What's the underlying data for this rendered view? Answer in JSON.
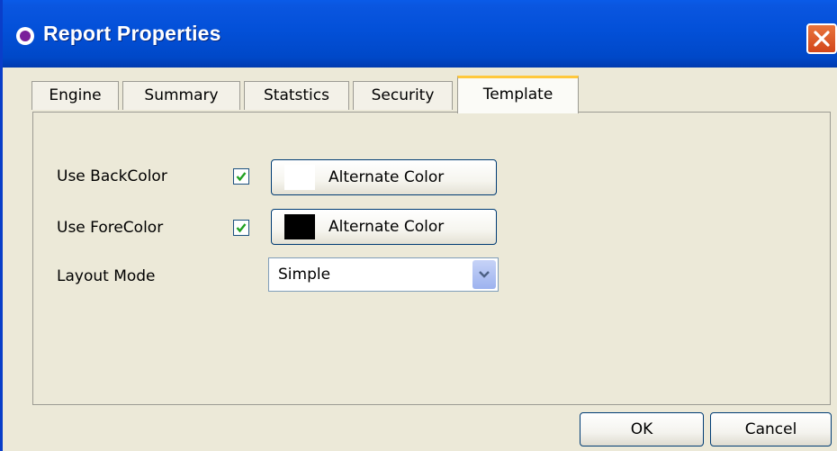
{
  "window": {
    "title": "Report Properties",
    "icon": "report-app-icon",
    "close_icon": "close-icon"
  },
  "tabs": [
    {
      "label": "Engine",
      "active": false
    },
    {
      "label": "Summary",
      "active": false
    },
    {
      "label": "Statstics",
      "active": false
    },
    {
      "label": "Security",
      "active": false
    },
    {
      "label": "Template",
      "active": true
    }
  ],
  "template": {
    "use_backcolor": {
      "label": "Use BackColor",
      "checked": true,
      "button_label": "Alternate Color",
      "swatch_color": "#ffffff"
    },
    "use_forecolor": {
      "label": "Use ForeColor",
      "checked": true,
      "button_label": "Alternate Color",
      "swatch_color": "#000000"
    },
    "layout_mode": {
      "label": "Layout Mode",
      "value": "Simple"
    }
  },
  "buttons": {
    "ok_label": "OK",
    "cancel_label": "Cancel"
  },
  "colors": {
    "titlebar": "#0350d8",
    "dialog_bg": "#ece9d8",
    "active_tab_accent": "#ffc83c",
    "check_green": "#21a121"
  }
}
